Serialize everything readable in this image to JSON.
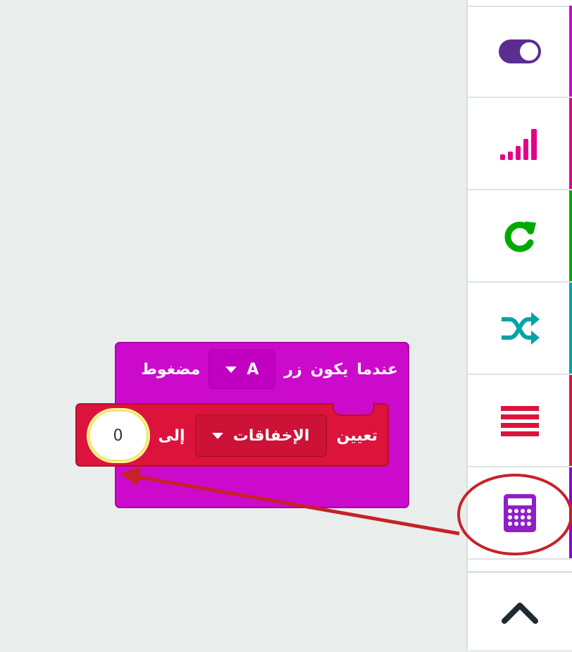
{
  "toolbox": {
    "categories": [
      {
        "name": "input",
        "icon": "toggle-icon",
        "color": "#5c2d91"
      },
      {
        "name": "radio",
        "icon": "signal-bars-icon",
        "color": "#e3008c"
      },
      {
        "name": "loops",
        "icon": "refresh-icon",
        "color": "#00aa00"
      },
      {
        "name": "logic",
        "icon": "shuffle-icon",
        "color": "#00a4a6"
      },
      {
        "name": "variables",
        "icon": "lines-icon",
        "color": "#dc143c"
      },
      {
        "name": "math",
        "icon": "calculator-icon",
        "color": "#9400d3"
      }
    ],
    "more_icon": "chevron-up-icon"
  },
  "event_block": {
    "label_when": "عندما",
    "label_is": "يكون",
    "label_button": "زر",
    "button_value": "A",
    "label_pressed": "مضغوط",
    "color": "#cc0acc"
  },
  "set_block": {
    "label_set": "تعيين",
    "variable": "الإخفاقات",
    "label_to": "إلى",
    "value": "0",
    "color": "#dc143c"
  },
  "annotation": {
    "color": "#c62228"
  }
}
